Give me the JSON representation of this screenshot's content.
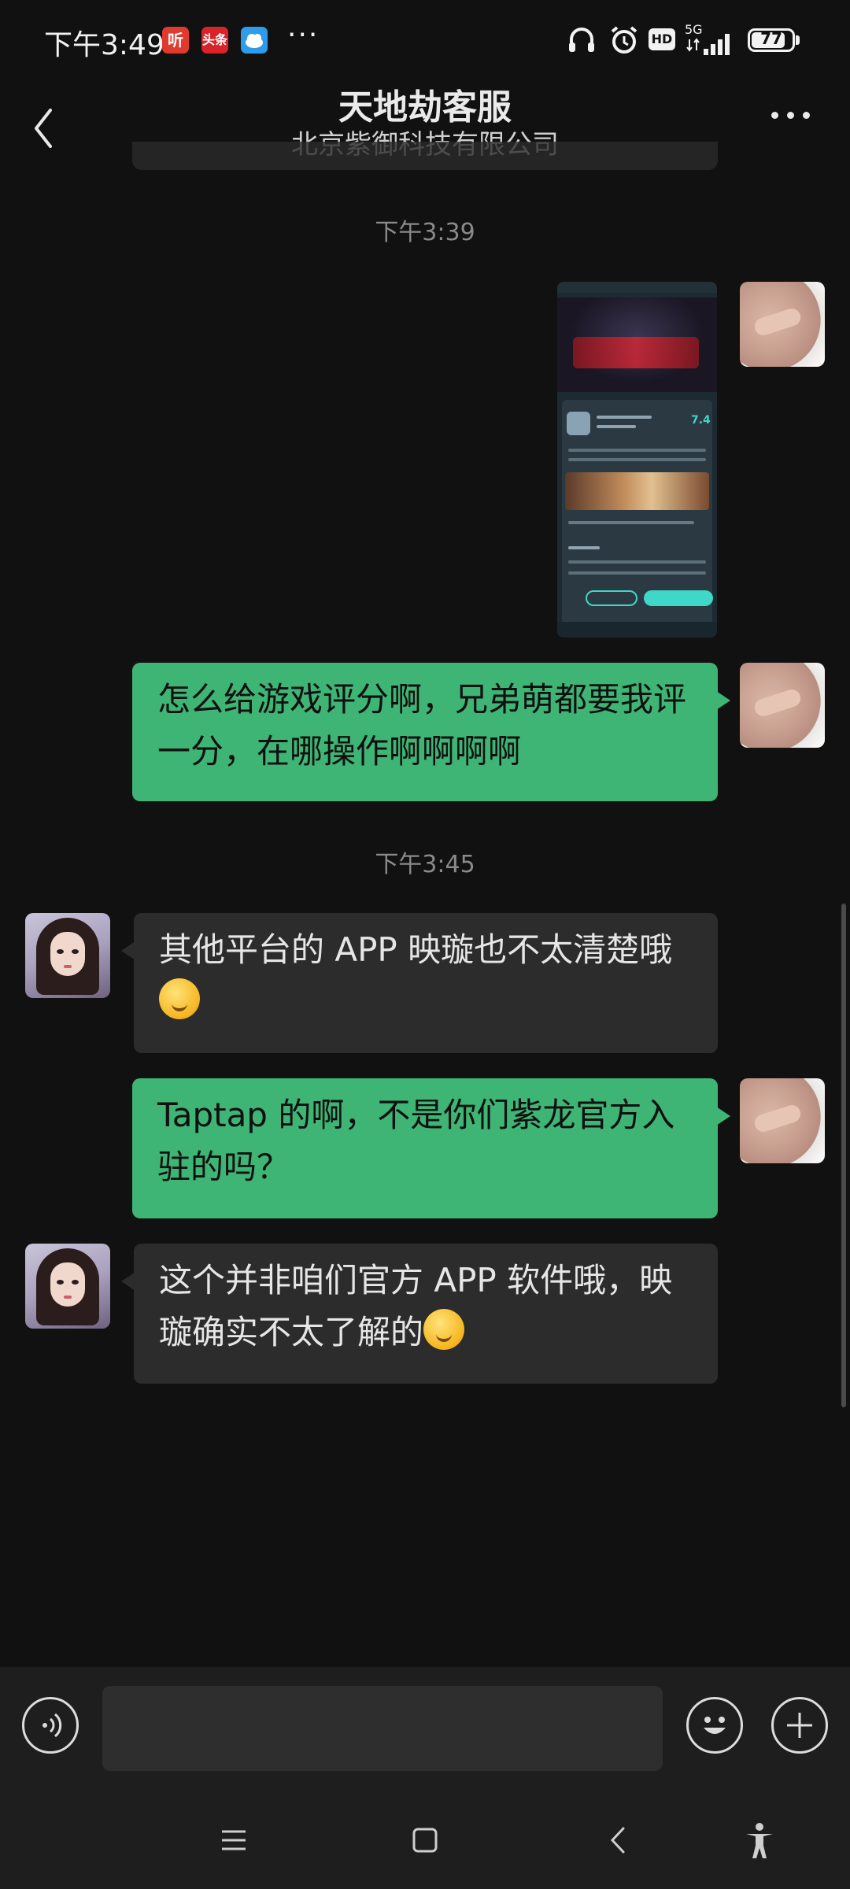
{
  "status_bar": {
    "time": "下午3:49",
    "network": "5G",
    "hd": "HD",
    "battery": "77",
    "app_badges": [
      "听",
      "头条"
    ]
  },
  "header": {
    "title": "天地劫客服",
    "subtitle": "北京紫御科技有限公司"
  },
  "messages": [
    {
      "type": "timestamp",
      "text": "下午3:39"
    },
    {
      "type": "image",
      "from": "me"
    },
    {
      "type": "text",
      "from": "me",
      "text": "怎么给游戏评分啊，兄弟萌都要我评一分，在哪操作啊啊啊啊"
    },
    {
      "type": "timestamp",
      "text": "下午3:45"
    },
    {
      "type": "text",
      "from": "agent",
      "text": "其他平台的 APP 映璇也不太清楚哦"
    },
    {
      "type": "text",
      "from": "me",
      "text": "Taptap 的啊，不是你们紫龙官方入驻的吗？"
    },
    {
      "type": "text",
      "from": "agent",
      "text": "这个并非咱们官方 APP 软件哦，映璇确实不太了解的"
    }
  ],
  "thumbnail": {
    "score": "7.4"
  },
  "input": {
    "value": "",
    "placeholder": ""
  },
  "colors": {
    "background": "#111111",
    "my_bubble": "#3eb575",
    "agent_bubble": "#2c2c2c",
    "input_bar": "#1e1e1e"
  },
  "icons": {
    "back": "chevron-left-icon",
    "more": "more-dots-icon",
    "voice": "voice-icon",
    "emoji": "emoji-icon",
    "plus": "plus-icon",
    "nav_menu": "menu-icon",
    "nav_home": "home-square-icon",
    "nav_back": "back-triangle-icon",
    "accessibility": "accessibility-icon"
  }
}
